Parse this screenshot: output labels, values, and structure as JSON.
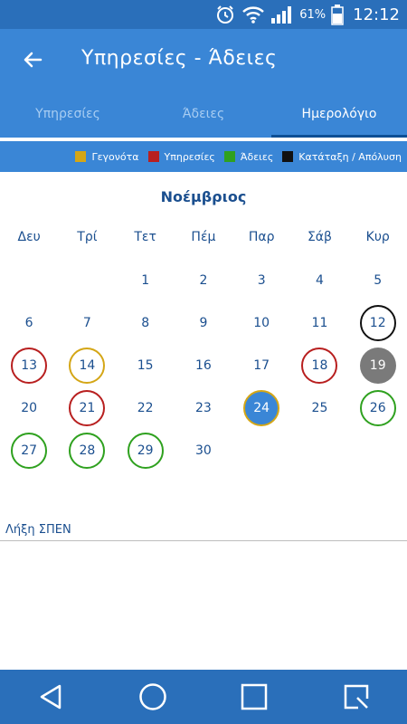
{
  "status": {
    "battery_text": "61%",
    "time": "12:12"
  },
  "appbar": {
    "title": "Υπηρεσίες - Άδειες"
  },
  "tabs": [
    {
      "label": "Υπηρεσίες",
      "active": false
    },
    {
      "label": "Άδειες",
      "active": false
    },
    {
      "label": "Ημερολόγιο",
      "active": true
    }
  ],
  "legend": [
    {
      "label": "Γεγονότα",
      "color": "#d4a616"
    },
    {
      "label": "Υπηρεσίες",
      "color": "#b81f1f"
    },
    {
      "label": "Άδειες",
      "color": "#2fa11f"
    },
    {
      "label": "Κατάταξη / Απόλυση",
      "color": "#111111"
    }
  ],
  "calendar": {
    "month": "Νοέμβριος",
    "weekdays": [
      "Δευ",
      "Τρί",
      "Τετ",
      "Πέμ",
      "Παρ",
      "Σάβ",
      "Κυρ"
    ],
    "weeks": [
      [
        null,
        null,
        "1",
        "2",
        "3",
        "4",
        "5"
      ],
      [
        "6",
        "7",
        "8",
        "9",
        "10",
        "11",
        "12"
      ],
      [
        "13",
        "14",
        "15",
        "16",
        "17",
        "18",
        "19"
      ],
      [
        "20",
        "21",
        "22",
        "23",
        "24",
        "25",
        "26"
      ],
      [
        "27",
        "28",
        "29",
        "30",
        null,
        null,
        null
      ]
    ],
    "marked": {
      "12": "black",
      "13": "red",
      "14": "yellow",
      "18": "red",
      "19": "gray",
      "21": "red",
      "24": "selected",
      "26": "green",
      "27": "green",
      "28": "green",
      "29": "green"
    }
  },
  "note": {
    "text": "Λήξη ΣΠΕΝ"
  }
}
